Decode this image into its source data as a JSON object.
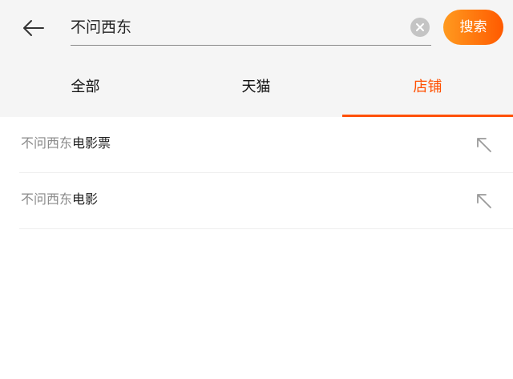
{
  "search": {
    "query": "不问西东",
    "button_label": "搜索"
  },
  "tabs": [
    {
      "label": "全部",
      "active": false
    },
    {
      "label": "天猫",
      "active": false
    },
    {
      "label": "店铺",
      "active": true
    }
  ],
  "suggestions": [
    {
      "prefix": "不问西东",
      "suffix": "电影票"
    },
    {
      "prefix": "不问西东",
      "suffix": "电影"
    }
  ],
  "colors": {
    "accent": "#ff5000",
    "button_gradient_start": "#ff9a1f",
    "button_gradient_end": "#ff5a00",
    "header_bg": "#f5f5f5"
  },
  "icons": {
    "back": "arrow-left-icon",
    "clear": "clear-circle-icon",
    "fill": "arrow-up-left-icon"
  }
}
